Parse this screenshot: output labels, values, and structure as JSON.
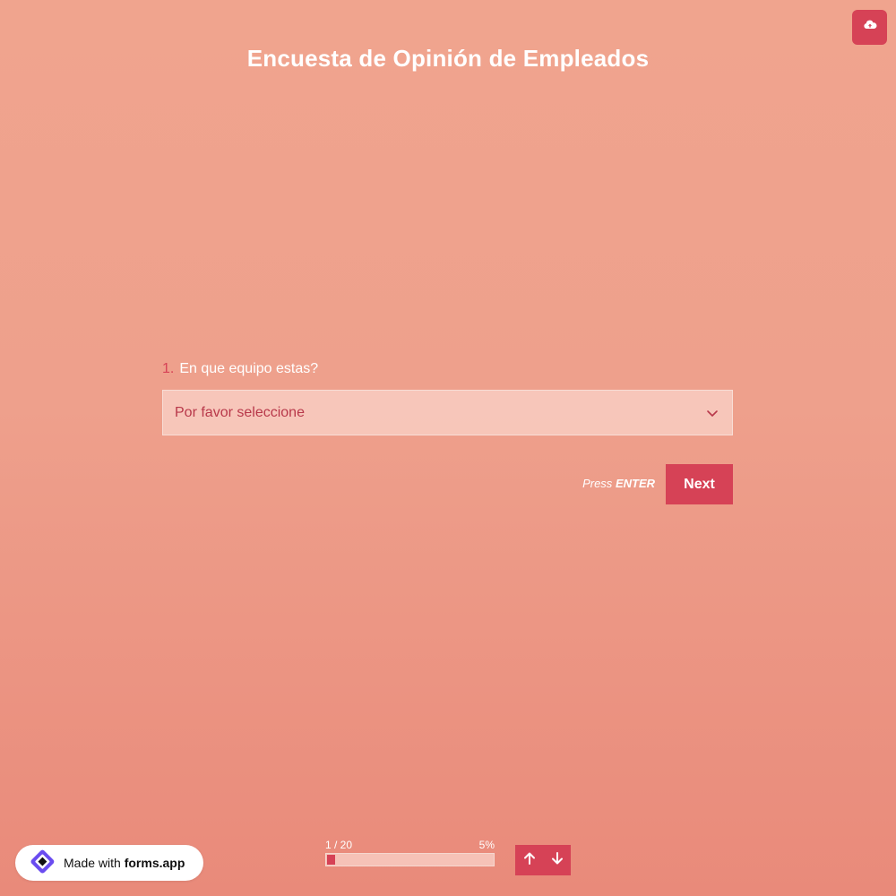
{
  "header": {
    "title": "Encuesta de Opinión de Empleados"
  },
  "toolbar": {
    "upload_icon": "cloud-upload-icon"
  },
  "question": {
    "number": "1.",
    "label": "En que equipo estas?",
    "dropdown": {
      "selected": "Por favor seleccione",
      "icon": "chevron-down-icon"
    }
  },
  "actions": {
    "press_hint_prefix": "Press",
    "press_hint_key": "ENTER",
    "next_label": "Next"
  },
  "badge": {
    "made_with": "Made with",
    "brand": "forms.app"
  },
  "progress": {
    "count": "1 / 20",
    "percent_label": "5%",
    "value": 0.05
  },
  "navigation": {
    "up_icon": "arrow-up-icon",
    "down_icon": "arrow-down-icon"
  },
  "colors": {
    "accent": "#d64256",
    "background_top": "#f0a48e",
    "background_bottom": "#e98a7a",
    "text": "#ffffff",
    "logo": "#6a4cf0"
  }
}
